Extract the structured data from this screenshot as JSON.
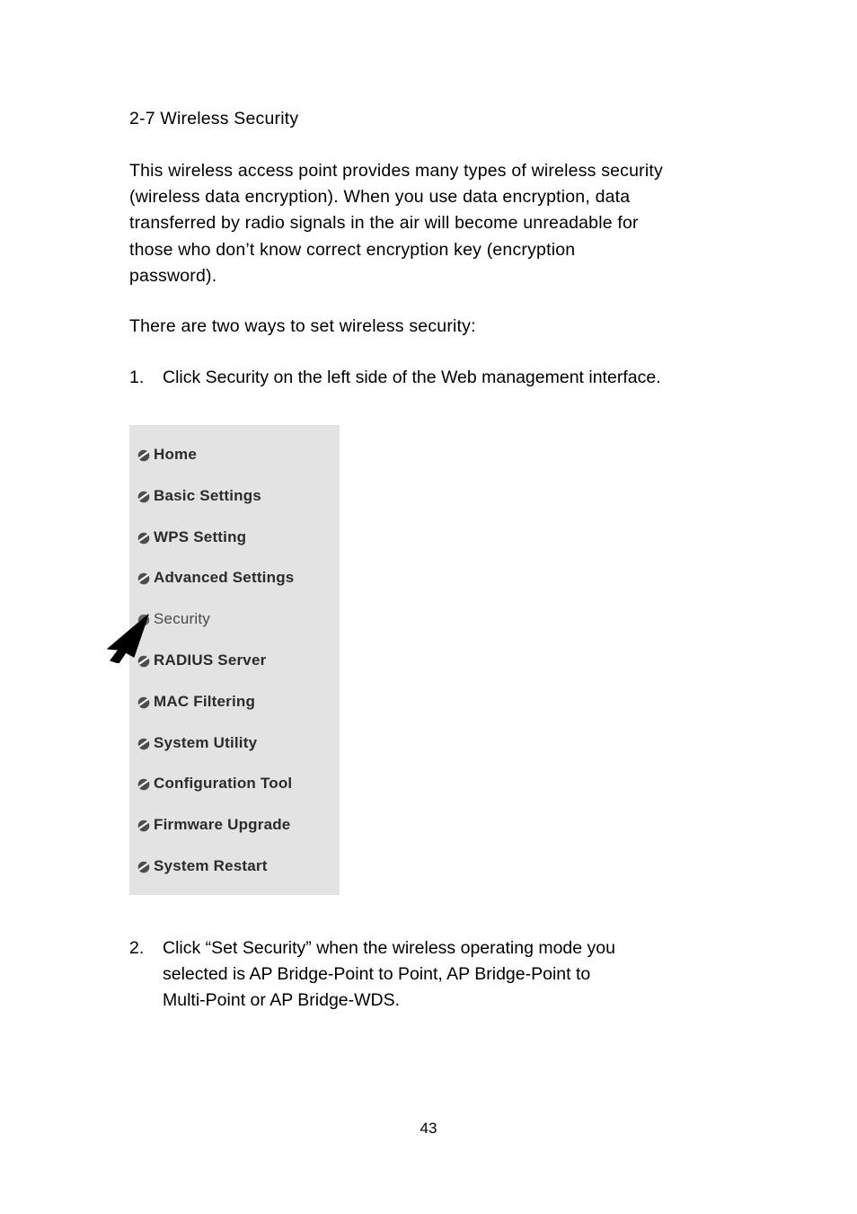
{
  "document": {
    "section_title": "2-7 Wireless Security",
    "intro_paragraph": "This wireless access point provides many types of wireless security\n(wireless data encryption). When you use data encryption, data\ntransferred by radio signals in the air will become unreadable for\nthose who don’t know correct encryption key (encryption\npassword).",
    "ways_line": "There are two ways to set wireless security:",
    "page_number": "43"
  },
  "steps": [
    {
      "number": "1.",
      "text": "Click Security on the left side of the Web management interface."
    },
    {
      "number": "2.",
      "text": "Click “Set Security” when the wireless operating mode you\nselected is AP Bridge-Point to Point, AP Bridge-Point to\nMulti-Point or AP Bridge-WDS."
    }
  ],
  "menu_panel": {
    "background_color": "#e3e3e3",
    "bullet_icon": "slashed-circle-icon",
    "items": [
      {
        "label": "Home",
        "active": false
      },
      {
        "label": "Basic Settings",
        "active": false
      },
      {
        "label": "WPS Setting",
        "active": false
      },
      {
        "label": "Advanced Settings",
        "active": false
      },
      {
        "label": "Security",
        "active": true
      },
      {
        "label": "RADIUS Server",
        "active": false
      },
      {
        "label": "MAC Filtering",
        "active": false
      },
      {
        "label": "System Utility",
        "active": false
      },
      {
        "label": "Configuration Tool",
        "active": false
      },
      {
        "label": "Firmware Upgrade",
        "active": false
      },
      {
        "label": "System Restart",
        "active": false
      }
    ]
  },
  "cursor": {
    "icon": "mouse-pointer-icon",
    "color": "#000000",
    "points_at": "Security"
  }
}
